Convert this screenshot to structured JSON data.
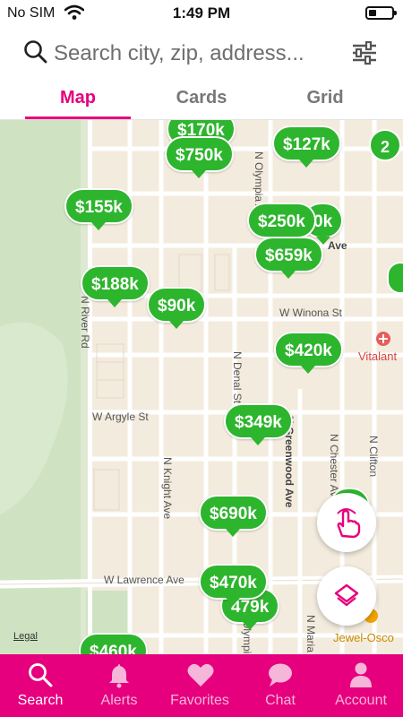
{
  "status_bar": {
    "carrier": "No SIM",
    "time": "1:49 PM"
  },
  "search": {
    "placeholder": "Search city, zip, address..."
  },
  "tabs": [
    {
      "label": "Map",
      "active": true
    },
    {
      "label": "Cards",
      "active": false
    },
    {
      "label": "Grid",
      "active": false
    }
  ],
  "map": {
    "streets": {
      "river_rd": "N River Rd",
      "winona": "W Winona St",
      "argyle": "W Argyle St",
      "lawrence": "W Lawrence Ave",
      "denal": "N Denal St",
      "knight": "N Knight Ave",
      "greenwood": "N Greenwood Ave",
      "chester": "N Chester Ave",
      "clifton": "N Clifton",
      "olympia": "N Olympia Ave",
      "olympia2": "N Olympia Ave",
      "ave_fragment": "Ave",
      "maria": "N Maria"
    },
    "pois": {
      "vitalant": "Vitalant",
      "jewel_osco": "Jewel-Osco"
    },
    "legal": "Legal",
    "pins": [
      {
        "label": "$170k"
      },
      {
        "label": "$750k"
      },
      {
        "label": "$127k"
      },
      {
        "label": "$155k"
      },
      {
        "label": "$250k"
      },
      {
        "label": "0k"
      },
      {
        "label": "$659k"
      },
      {
        "label": "$188k"
      },
      {
        "label": "$90k"
      },
      {
        "label": "$420k"
      },
      {
        "label": "$349k"
      },
      {
        "label": "$690k"
      },
      {
        "label": "0k"
      },
      {
        "label": "$470k"
      },
      {
        "label": "479k"
      },
      {
        "label": "$460k"
      }
    ],
    "clusters": [
      {
        "label": "2"
      }
    ]
  },
  "bottom_nav": [
    {
      "label": "Search",
      "icon": "search-icon",
      "active": true
    },
    {
      "label": "Alerts",
      "icon": "bell-icon",
      "active": false
    },
    {
      "label": "Favorites",
      "icon": "heart-icon",
      "active": false
    },
    {
      "label": "Chat",
      "icon": "chat-icon",
      "active": false
    },
    {
      "label": "Account",
      "icon": "person-icon",
      "active": false
    }
  ],
  "colors": {
    "accent": "#e6007e",
    "pin_green": "#2db52d",
    "map_bg": "#f3ebdd",
    "park_green": "#cfe3c2"
  }
}
